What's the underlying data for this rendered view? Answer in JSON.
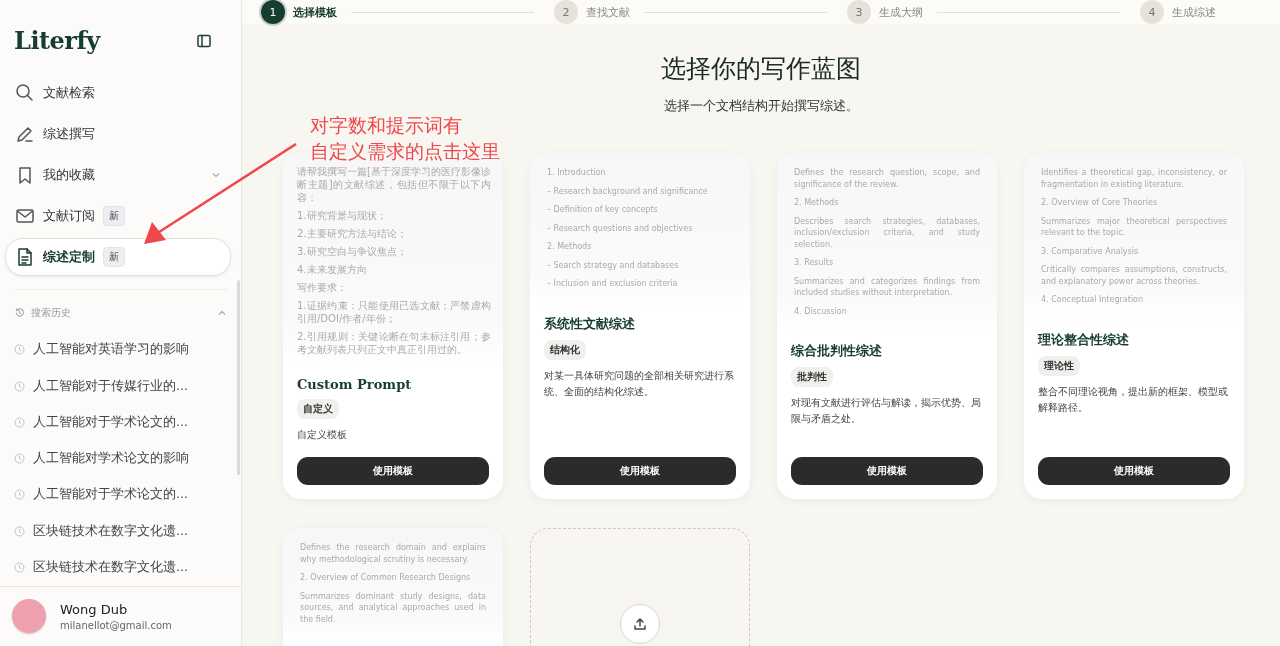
{
  "sidebar": {
    "logo": "Literfy",
    "nav": [
      {
        "label": "文献检索",
        "selected": false
      },
      {
        "label": "综述撰写",
        "selected": false
      },
      {
        "label": "我的收藏",
        "selected": false,
        "expanded": false
      },
      {
        "label": "文献订阅",
        "selected": false,
        "badge": "新"
      },
      {
        "label": "综述定制",
        "selected": true,
        "badge": "新"
      }
    ],
    "history": {
      "title": "搜索历史",
      "expanded": true,
      "items": [
        "人工智能对英语学习的影响",
        "人工智能对于传媒行业的...",
        "人工智能对于学术论文的...",
        "人工智能对学术论文的影响",
        "人工智能对于学术论文的...",
        "区块链技术在数字文化遗...",
        "区块链技术在数字文化遗..."
      ]
    },
    "user": {
      "name": "Wong Dub",
      "email": "milanellot@gmail.com"
    }
  },
  "steps": [
    {
      "number": "1",
      "label": "选择模板",
      "selected": true
    },
    {
      "number": "2",
      "label": "查找文献",
      "selected": false
    },
    {
      "number": "3",
      "label": "生成大纲",
      "selected": false
    },
    {
      "number": "4",
      "label": "生成综述",
      "selected": false
    }
  ],
  "heading": {
    "title": "选择你的写作蓝图",
    "subtitle": "选择一个文档结构开始撰写综述。"
  },
  "annotation": {
    "lines": [
      "对字数和提示词有",
      "自定义需求的点击这里"
    ]
  },
  "templates": [
    {
      "kind": "template",
      "preview": [
        "请帮我撰写一篇[基于深度学习的医疗影像诊断主题]的文献综述，包括但不限于以下内容：",
        "1.研究背景与现状；",
        "2.主要研究方法与结论；",
        "3.研究空白与争议焦点；",
        "4.未来发展方向",
        "写作要求：",
        "1.证据约束：只能使用已选文献；严禁虚构引用/DOI/作者/年份；",
        "2.引用规则：关键论断在句末标注引用；参考文献列表只列正文中真正引用过的。"
      ],
      "title": "Custom Prompt",
      "tag": "自定义",
      "description": "自定义模板",
      "button": "使用模板"
    },
    {
      "kind": "template",
      "preview": [
        "1. Introduction",
        "– Research background and significance",
        "– Definition of key concepts",
        "– Research questions and objectives",
        "2. Methods",
        "– Search strategy and databases",
        "– Inclusion and exclusion criteria"
      ],
      "title": "系统性文献综述",
      "tag": "结构化",
      "description": "对某一具体研究问题的全部相关研究进行系统、全面的结构化综述。",
      "button": "使用模板"
    },
    {
      "kind": "template",
      "preview": [
        "Defines the research question, scope, and significance of the review.",
        "2. Methods",
        "Describes search strategies, databases, inclusion/exclusion criteria, and study selection.",
        "3. Results",
        "Summarizes and categorizes findings from included studies without interpretation.",
        "4. Discussion"
      ],
      "title": "综合批判性综述",
      "tag": "批判性",
      "description": "对现有文献进行评估与解读，揭示优势、局限与矛盾之处。",
      "button": "使用模板"
    },
    {
      "kind": "template",
      "preview": [
        "Identifies a theoretical gap, inconsistency, or fragmentation in existing literature.",
        "2. Overview of Core Theories",
        "Summarizes major theoretical perspectives relevant to the topic.",
        "3. Comparative Analysis",
        "Critically compares assumptions, constructs, and explanatory power across theories.",
        "4. Conceptual Integration"
      ],
      "title": "理论整合性综述",
      "tag": "理论性",
      "description": "整合不同理论视角，提出新的框架、模型或解释路径。",
      "button": "使用模板"
    },
    {
      "kind": "template",
      "preview": [
        "Defines the research domain and explains why methodological scrutiny is necessary.",
        "2. Overview of Common Research Designs",
        "Summarizes dominant study designs, data sources, and analytical approaches used in the field."
      ]
    },
    {
      "kind": "upload"
    }
  ]
}
